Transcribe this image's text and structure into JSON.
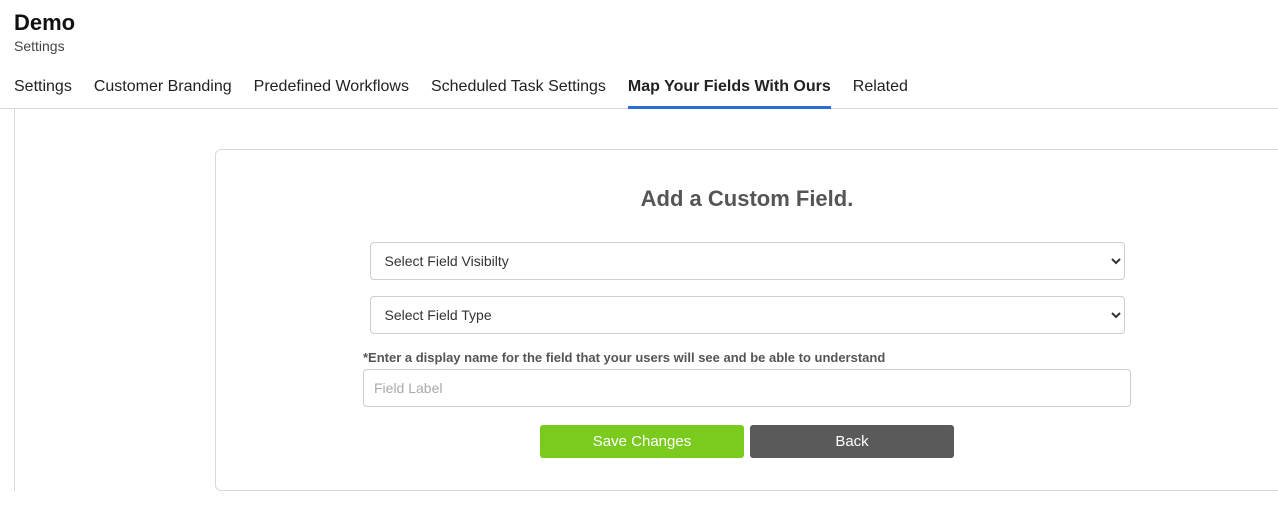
{
  "header": {
    "title": "Demo",
    "subtitle": "Settings"
  },
  "tabs": [
    {
      "label": "Settings"
    },
    {
      "label": "Customer Branding"
    },
    {
      "label": "Predefined Workflows"
    },
    {
      "label": "Scheduled Task Settings"
    },
    {
      "label": "Map Your Fields With Ours"
    },
    {
      "label": "Related"
    }
  ],
  "panel": {
    "title": "Add a Custom Field.",
    "visibility_placeholder": "Select Field Visibilty",
    "type_placeholder": "Select Field Type",
    "help_text": "*Enter a display name for the field that your users will see and be able to understand",
    "label_placeholder": "Field Label",
    "save_label": "Save Changes",
    "back_label": "Back"
  }
}
